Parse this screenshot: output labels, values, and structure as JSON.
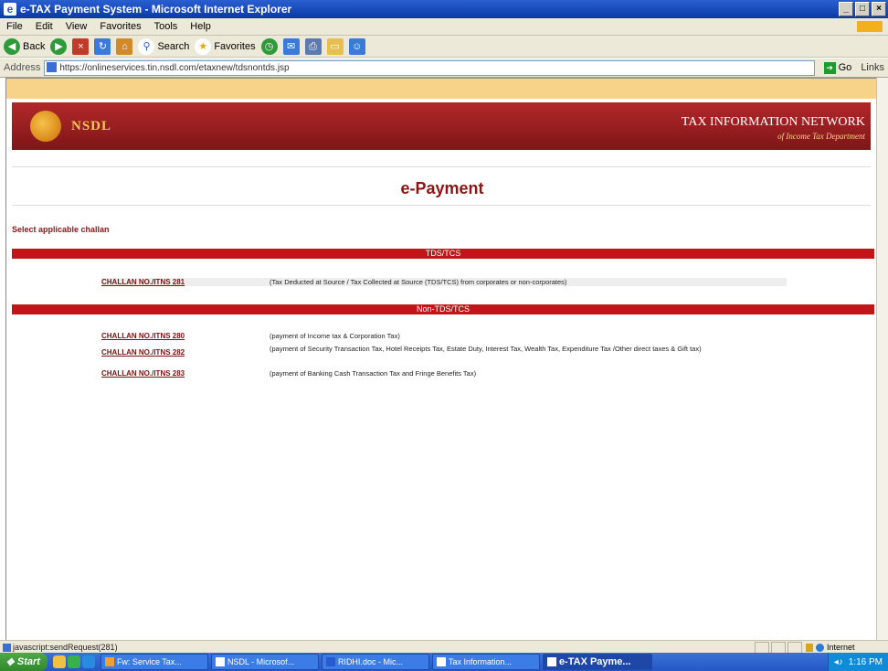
{
  "window": {
    "title": "e-TAX Payment System - Microsoft Internet Explorer",
    "controls": [
      "_",
      "□",
      "×"
    ]
  },
  "menu": [
    "File",
    "Edit",
    "View",
    "Favorites",
    "Tools",
    "Help"
  ],
  "toolbar": {
    "back_label": "Back",
    "search_label": "Search",
    "favorites_label": "Favorites"
  },
  "address": {
    "label": "Address",
    "url": "https://onlineservices.tin.nsdl.com/etaxnew/tdsnontds.jsp",
    "go_label": "Go",
    "links_label": "Links"
  },
  "banner": {
    "logo_text": "NSDL",
    "tin_title": "TAX INFORMATION NETWORK",
    "tin_subtitle": "of Income Tax Department"
  },
  "page": {
    "title": "e-Payment",
    "select_label": "Select applicable challan"
  },
  "sections": [
    {
      "label": "TDS/TCS",
      "challans": [
        {
          "name": "CHALLAN NO./ITNS 281",
          "desc": "(Tax Deducted at Source / Tax Collected at Source (TDS/TCS) from corporates or non-corporates)"
        }
      ]
    },
    {
      "label": "Non-TDS/TCS",
      "challans": [
        {
          "name": "CHALLAN NO./ITNS 280",
          "desc": "(payment of Income tax & Corporation Tax)"
        },
        {
          "name": "CHALLAN NO./ITNS 282",
          "desc": "(payment of Security Transaction Tax, Hotel Receipts Tax, Estate Duty, Interest Tax, Wealth Tax, Expenditure Tax /Other direct taxes & Gift tax)"
        },
        {
          "name": "CHALLAN NO./ITNS 283",
          "desc": "(payment of Banking Cash Transaction Tax and Fringe Benefits Tax)"
        }
      ]
    }
  ],
  "statusbar": {
    "text": "javascript:sendRequest(281)",
    "zone": "Internet"
  },
  "taskbar": {
    "start": "Start",
    "tasks": [
      "Fw: Service Tax...",
      "NSDL - Microsof...",
      "RIDHI.doc - Mic...",
      "Tax Information...",
      "e-TAX Payme..."
    ],
    "time": "1:16 PM"
  }
}
